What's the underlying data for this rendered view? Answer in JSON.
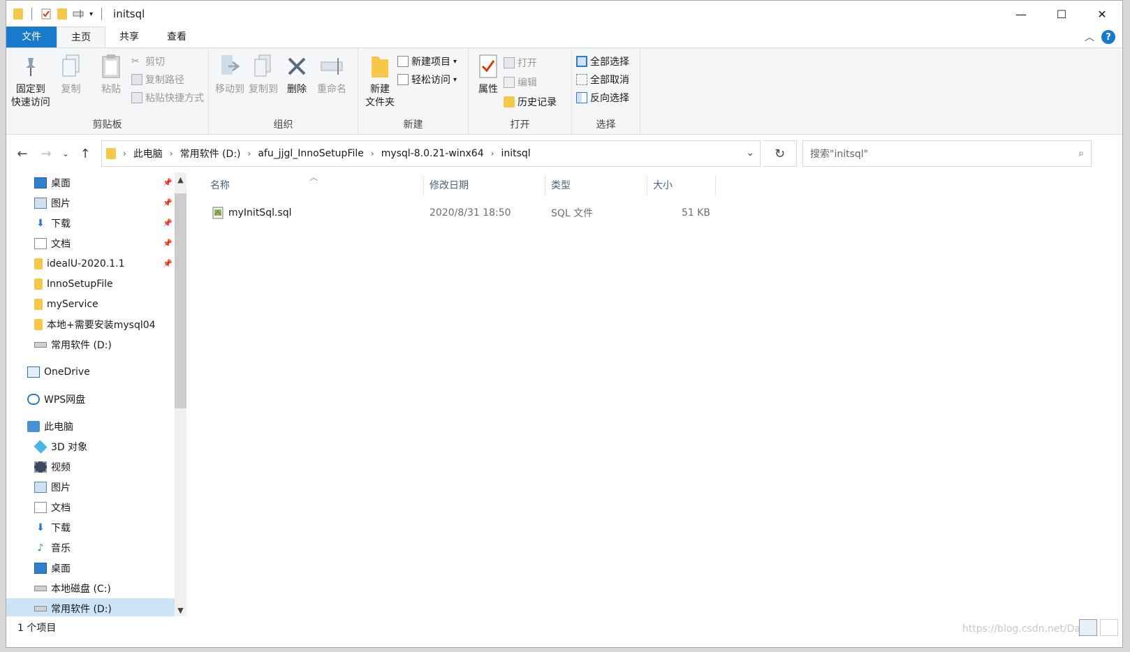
{
  "window": {
    "title": "initsql"
  },
  "tabs": [
    "文件",
    "主页",
    "共享",
    "查看"
  ],
  "ribbon": {
    "clipboard": {
      "label": "剪贴板",
      "pin": "固定到\n快速访问",
      "copy": "复制",
      "paste": "粘贴",
      "cut": "剪切",
      "copy_path": "复制路径",
      "paste_shortcut": "粘贴快捷方式"
    },
    "organize": {
      "label": "组织",
      "move_to": "移动到",
      "copy_to": "复制到",
      "delete": "删除",
      "rename": "重命名"
    },
    "new": {
      "label": "新建",
      "new_folder": "新建\n文件夹",
      "new_item": "新建项目",
      "easy_access": "轻松访问"
    },
    "open": {
      "label": "打开",
      "properties": "属性",
      "open": "打开",
      "edit": "编辑",
      "history": "历史记录"
    },
    "select": {
      "label": "选择",
      "select_all": "全部选择",
      "select_none": "全部取消",
      "invert": "反向选择"
    }
  },
  "address": {
    "crumbs": [
      "此电脑",
      "常用软件 (D:)",
      "afu_jjgl_InnoSetupFile",
      "mysql-8.0.21-winx64",
      "initsql"
    ],
    "search_placeholder": "搜索\"initsql\""
  },
  "navpane": {
    "items": [
      {
        "label": "桌面",
        "icon": "desktop-icon",
        "pinned": true
      },
      {
        "label": "图片",
        "icon": "pictures-icon",
        "pinned": true
      },
      {
        "label": "下载",
        "icon": "download-icon",
        "pinned": true
      },
      {
        "label": "文档",
        "icon": "documents-icon",
        "pinned": true
      },
      {
        "label": "idealU-2020.1.1",
        "icon": "folder-icon",
        "pinned": true
      },
      {
        "label": "InnoSetupFile",
        "icon": "folder-icon",
        "pinned": false
      },
      {
        "label": "myService",
        "icon": "folder-icon",
        "pinned": false
      },
      {
        "label": "本地+需要安装mysql04",
        "icon": "folder-icon",
        "pinned": false
      },
      {
        "label": "常用软件 (D:)",
        "icon": "drive-icon",
        "pinned": false
      }
    ],
    "onedrive": "OneDrive",
    "wps": "WPS网盘",
    "thispc": "此电脑",
    "pc_items": [
      {
        "label": "3D 对象",
        "icon": "3d-objects-icon"
      },
      {
        "label": "视频",
        "icon": "video-icon"
      },
      {
        "label": "图片",
        "icon": "pictures-icon"
      },
      {
        "label": "文档",
        "icon": "documents-icon"
      },
      {
        "label": "下载",
        "icon": "download-icon"
      },
      {
        "label": "音乐",
        "icon": "music-icon"
      },
      {
        "label": "桌面",
        "icon": "desktop-icon"
      },
      {
        "label": "本地磁盘 (C:)",
        "icon": "drive-icon"
      },
      {
        "label": "常用软件 (D:)",
        "icon": "drive-icon"
      }
    ]
  },
  "columns": [
    "名称",
    "修改日期",
    "类型",
    "大小"
  ],
  "files": [
    {
      "name": "myInitSql.sql",
      "modified": "2020/8/31 18:50",
      "type": "SQL 文件",
      "size": "51 KB"
    }
  ],
  "status": {
    "count": "1 个项目"
  },
  "watermark": "https://blog.csdn.net/Da",
  "colors": {
    "accent": "#1979ca",
    "selection": "#cce4f7",
    "folder": "#f5c84a"
  }
}
